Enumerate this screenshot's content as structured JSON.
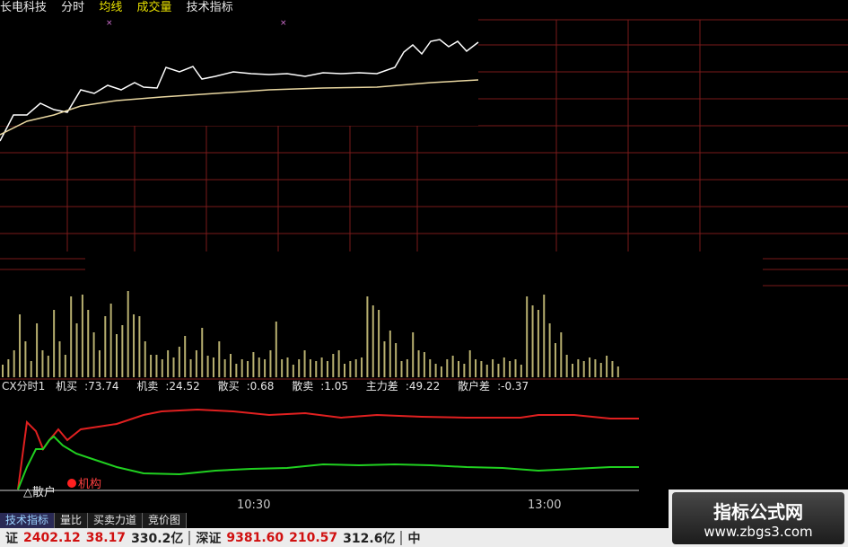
{
  "header": {
    "stock_name": "长电科技",
    "tabs": [
      "分时",
      "均线",
      "成交量",
      "技术指标"
    ]
  },
  "indicator": {
    "name": "CX分时1",
    "values": [
      {
        "label": "机买",
        "value": "73.74"
      },
      {
        "label": "机卖",
        "value": "24.52"
      },
      {
        "label": "散买",
        "value": "0.68"
      },
      {
        "label": "散卖",
        "value": "1.05"
      },
      {
        "label": "主力差",
        "value": "49.22"
      },
      {
        "label": "散户差",
        "value": "-0.37"
      }
    ],
    "legend_institution": "机构",
    "legend_retail": "散户"
  },
  "time_axis": {
    "t1": "10:30",
    "t2": "13:00"
  },
  "bottom_tabs": [
    "技术指标",
    "量比",
    "买卖力道",
    "竞价图"
  ],
  "status_bar": {
    "sh_name": "证",
    "sh_index": "2402.12",
    "sh_change": "38.17",
    "sh_amount": "330.2亿",
    "sz_name": "深证",
    "sz_index": "9381.60",
    "sz_change": "210.57",
    "sz_amount": "312.6亿",
    "extra": "中"
  },
  "watermark": {
    "title": "指标公式网",
    "url": "www.zbgs3.com"
  },
  "colors": {
    "grid": "#7a1a1a",
    "price_line": "#ffffff",
    "avg_line": "#e8d6a0",
    "volume_bar": "#b8b070",
    "institution_line": "#e02020",
    "retail_line": "#20d020",
    "institution_dot": "#ff2020",
    "header_yellow": "#e8e000",
    "status_up": "#d01010"
  }
}
